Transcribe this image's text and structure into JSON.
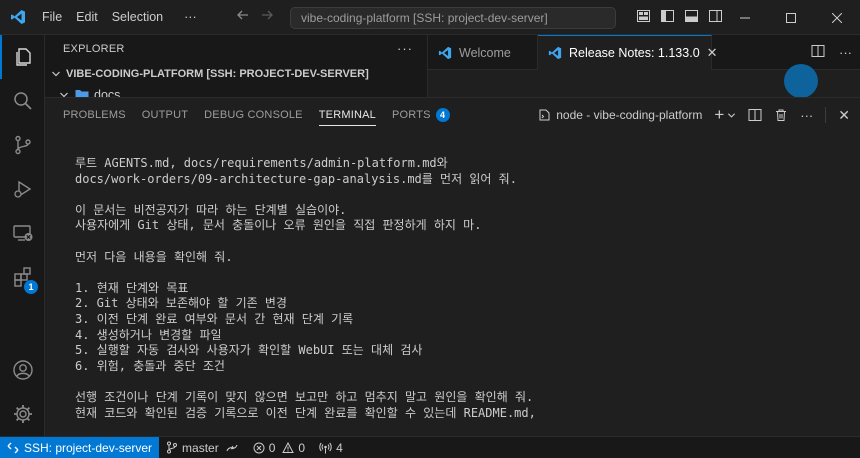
{
  "titlebar": {
    "menu": [
      "File",
      "Edit",
      "Selection",
      "···"
    ],
    "back_icon": "arrow-left-icon",
    "forward_icon": "arrow-right-icon",
    "search_text": "vibe-coding-platform [SSH: project-dev-server]",
    "window_controls": [
      "minimize-icon",
      "maximize-icon",
      "close-icon"
    ]
  },
  "activitybar": {
    "items": [
      "explorer-icon",
      "search-icon",
      "source-control-icon",
      "run-debug-icon",
      "remote-explorer-icon",
      "extensions-icon"
    ],
    "extensions_badge": "1",
    "bottom": [
      "account-icon",
      "settings-gear-icon"
    ]
  },
  "sidebar": {
    "title": "EXPLORER",
    "more": "···",
    "root": "VIBE-CODING-PLATFORM [SSH: PROJECT-DEV-SERVER]",
    "folder": "docs"
  },
  "editor": {
    "tabs": [
      {
        "label": "Welcome",
        "active": false
      },
      {
        "label": "Release Notes: 1.133.0",
        "active": true
      }
    ],
    "close_glyph": "✕"
  },
  "panel": {
    "tabs": [
      "PROBLEMS",
      "OUTPUT",
      "DEBUG CONSOLE",
      "TERMINAL",
      "PORTS"
    ],
    "active_tab": "TERMINAL",
    "ports_count": "4",
    "terminal_name": "node - vibe-coding-platform",
    "add_glyph": "+",
    "close_glyph": "✕"
  },
  "terminal": {
    "prompt": "›",
    "lines": [
      "루트 AGENTS.md, docs/requirements/admin-platform.md와",
      "docs/work-orders/09-architecture-gap-analysis.md를 먼저 읽어 줘.",
      "",
      "이 문서는 비전공자가 따라 하는 단계별 실습이야.",
      "사용자에게 Git 상태, 문서 충돌이나 오류 원인을 직접 판정하게 하지 마.",
      "",
      "먼저 다음 내용을 확인해 줘.",
      "",
      "1. 현재 단계와 목표",
      "2. Git 상태와 보존해야 할 기존 변경",
      "3. 이전 단계 완료 여부와 문서 간 현재 단계 기록",
      "4. 생성하거나 변경할 파일",
      "5. 실행할 자동 검사와 사용자가 확인할 WebUI 또는 대체 검사",
      "6. 위험, 충돌과 중단 조건",
      "",
      "선행 조건이나 단계 기록이 맞지 않으면 보고만 하고 멈추지 말고 원인을 확인해 줘.",
      "현재 코드와 확인된 검증 기록으로 이전 단계 완료를 확인할 수 있는데 README.md,"
    ]
  },
  "statusbar": {
    "remote": "SSH: project-dev-server",
    "branch": "master",
    "errors": "0",
    "warnings": "0",
    "ports": "4"
  },
  "colors": {
    "accent": "#0078d4",
    "background": "#181818",
    "editor_background": "#1f1f1f"
  }
}
